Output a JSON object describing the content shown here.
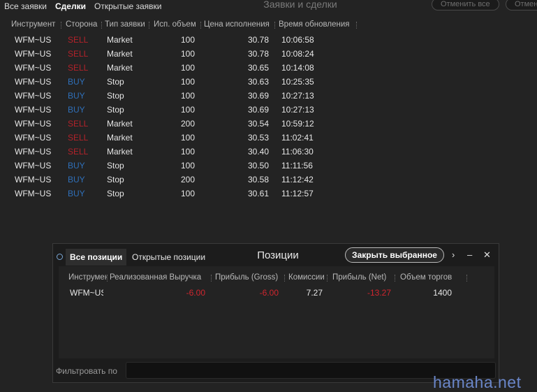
{
  "orders_window": {
    "title": "Заявки и сделки",
    "tabs": [
      {
        "label": "Все заявки",
        "active": false
      },
      {
        "label": "Сделки",
        "active": true
      },
      {
        "label": "Открытые заявки",
        "active": false
      }
    ],
    "cancel_all_label": "Отменить все",
    "cancel_label": "Отмен",
    "columns": [
      "Инструмент",
      "Сторона",
      "Тип заявки",
      "Исп. объем",
      "Цена исполнения",
      "Время обновления"
    ],
    "rows": [
      {
        "instrument": "WFM~US",
        "side": "SELL",
        "type": "Market",
        "qty": "100",
        "price": "30.78",
        "time": "10:06:58"
      },
      {
        "instrument": "WFM~US",
        "side": "SELL",
        "type": "Market",
        "qty": "100",
        "price": "30.78",
        "time": "10:08:24"
      },
      {
        "instrument": "WFM~US",
        "side": "SELL",
        "type": "Market",
        "qty": "100",
        "price": "30.65",
        "time": "10:14:08"
      },
      {
        "instrument": "WFM~US",
        "side": "BUY",
        "type": "Stop",
        "qty": "100",
        "price": "30.63",
        "time": "10:25:35"
      },
      {
        "instrument": "WFM~US",
        "side": "BUY",
        "type": "Stop",
        "qty": "100",
        "price": "30.69",
        "time": "10:27:13"
      },
      {
        "instrument": "WFM~US",
        "side": "BUY",
        "type": "Stop",
        "qty": "100",
        "price": "30.69",
        "time": "10:27:13"
      },
      {
        "instrument": "WFM~US",
        "side": "SELL",
        "type": "Market",
        "qty": "200",
        "price": "30.54",
        "time": "10:59:12"
      },
      {
        "instrument": "WFM~US",
        "side": "SELL",
        "type": "Market",
        "qty": "100",
        "price": "30.53",
        "time": "11:02:41"
      },
      {
        "instrument": "WFM~US",
        "side": "SELL",
        "type": "Market",
        "qty": "100",
        "price": "30.40",
        "time": "11:06:30"
      },
      {
        "instrument": "WFM~US",
        "side": "BUY",
        "type": "Stop",
        "qty": "100",
        "price": "30.50",
        "time": "11:11:56"
      },
      {
        "instrument": "WFM~US",
        "side": "BUY",
        "type": "Stop",
        "qty": "200",
        "price": "30.58",
        "time": "11:12:42"
      },
      {
        "instrument": "WFM~US",
        "side": "BUY",
        "type": "Stop",
        "qty": "100",
        "price": "30.61",
        "time": "11:12:57"
      }
    ],
    "colors": {
      "sell": "#b3222a",
      "buy": "#2f6fb8"
    }
  },
  "positions_panel": {
    "title": "Позиции",
    "tabs": [
      {
        "label": "Все позиции",
        "active": true
      },
      {
        "label": "Открытые позиции",
        "active": false
      }
    ],
    "close_selected_label": "Закрыть выбранное",
    "controls": {
      "expand": "›",
      "minimize": "–",
      "close": "✕"
    },
    "columns": [
      "Инструмент",
      "Реализованная Выручка",
      "Прибыль (Gross)",
      "Комиссии",
      "Прибыль (Net)",
      "Объем торгов"
    ],
    "rows": [
      {
        "instrument": "WFM~US",
        "realized": "-6.00",
        "gross": "-6.00",
        "commission": "7.27",
        "net": "-13.27",
        "volume": "1400"
      }
    ],
    "filter_label": "Фильтровать по",
    "filter_value": ""
  },
  "watermark": "hamaha.net"
}
